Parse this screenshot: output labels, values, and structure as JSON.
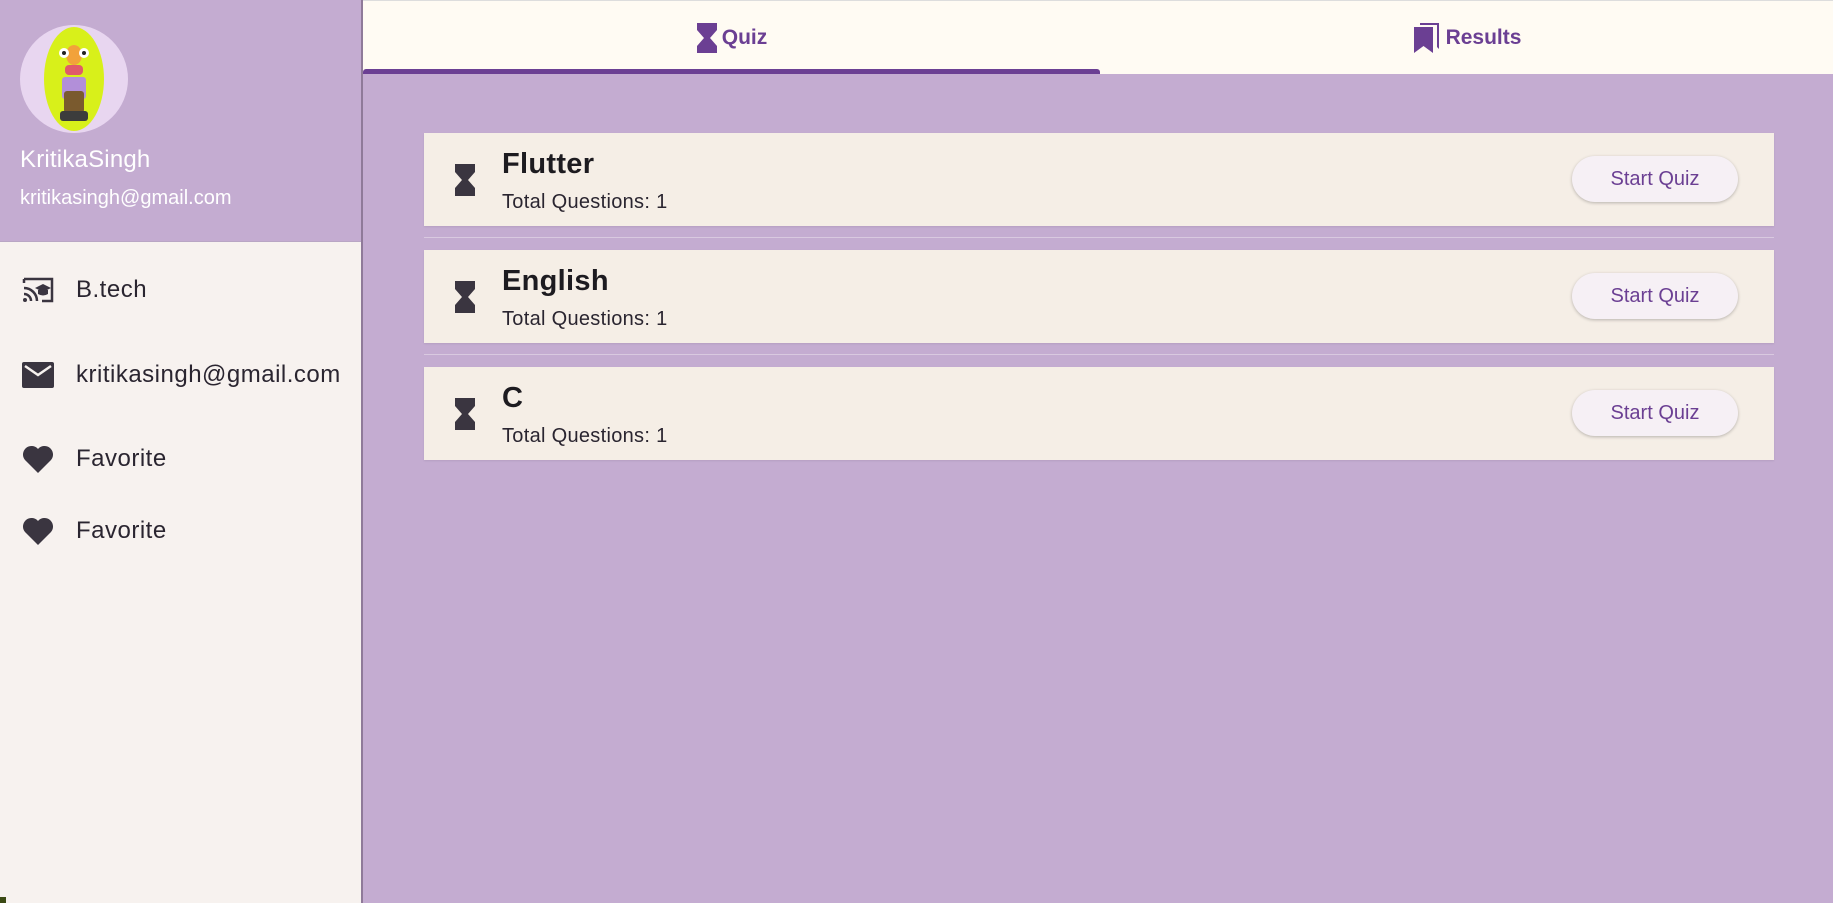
{
  "drawer": {
    "user_name": "KritikaSingh",
    "user_email": "kritikasingh@gmail.com",
    "items": [
      {
        "icon": "school-cast-icon",
        "label": "B.tech"
      },
      {
        "icon": "mail-icon",
        "label": "kritikasingh@gmail.com"
      },
      {
        "icon": "heart-icon",
        "label": "Favorite"
      },
      {
        "icon": "heart-icon",
        "label": "Favorite"
      }
    ]
  },
  "tabs": [
    {
      "icon": "hourglass-icon",
      "label": "Quiz",
      "selected": true
    },
    {
      "icon": "bookmarks-icon",
      "label": "Results",
      "selected": false
    }
  ],
  "quizzes": [
    {
      "title": "Flutter",
      "subtitle": "Total Questions: 1",
      "button": "Start Quiz"
    },
    {
      "title": "English",
      "subtitle": "Total Questions: 1",
      "button": "Start Quiz"
    },
    {
      "title": "C",
      "subtitle": "Total Questions: 1",
      "button": "Start Quiz"
    }
  ],
  "colors": {
    "accent": "#6b3f93",
    "background": "#c4acd1",
    "card": "#f5eee6",
    "tabbar": "#fffbf3"
  }
}
